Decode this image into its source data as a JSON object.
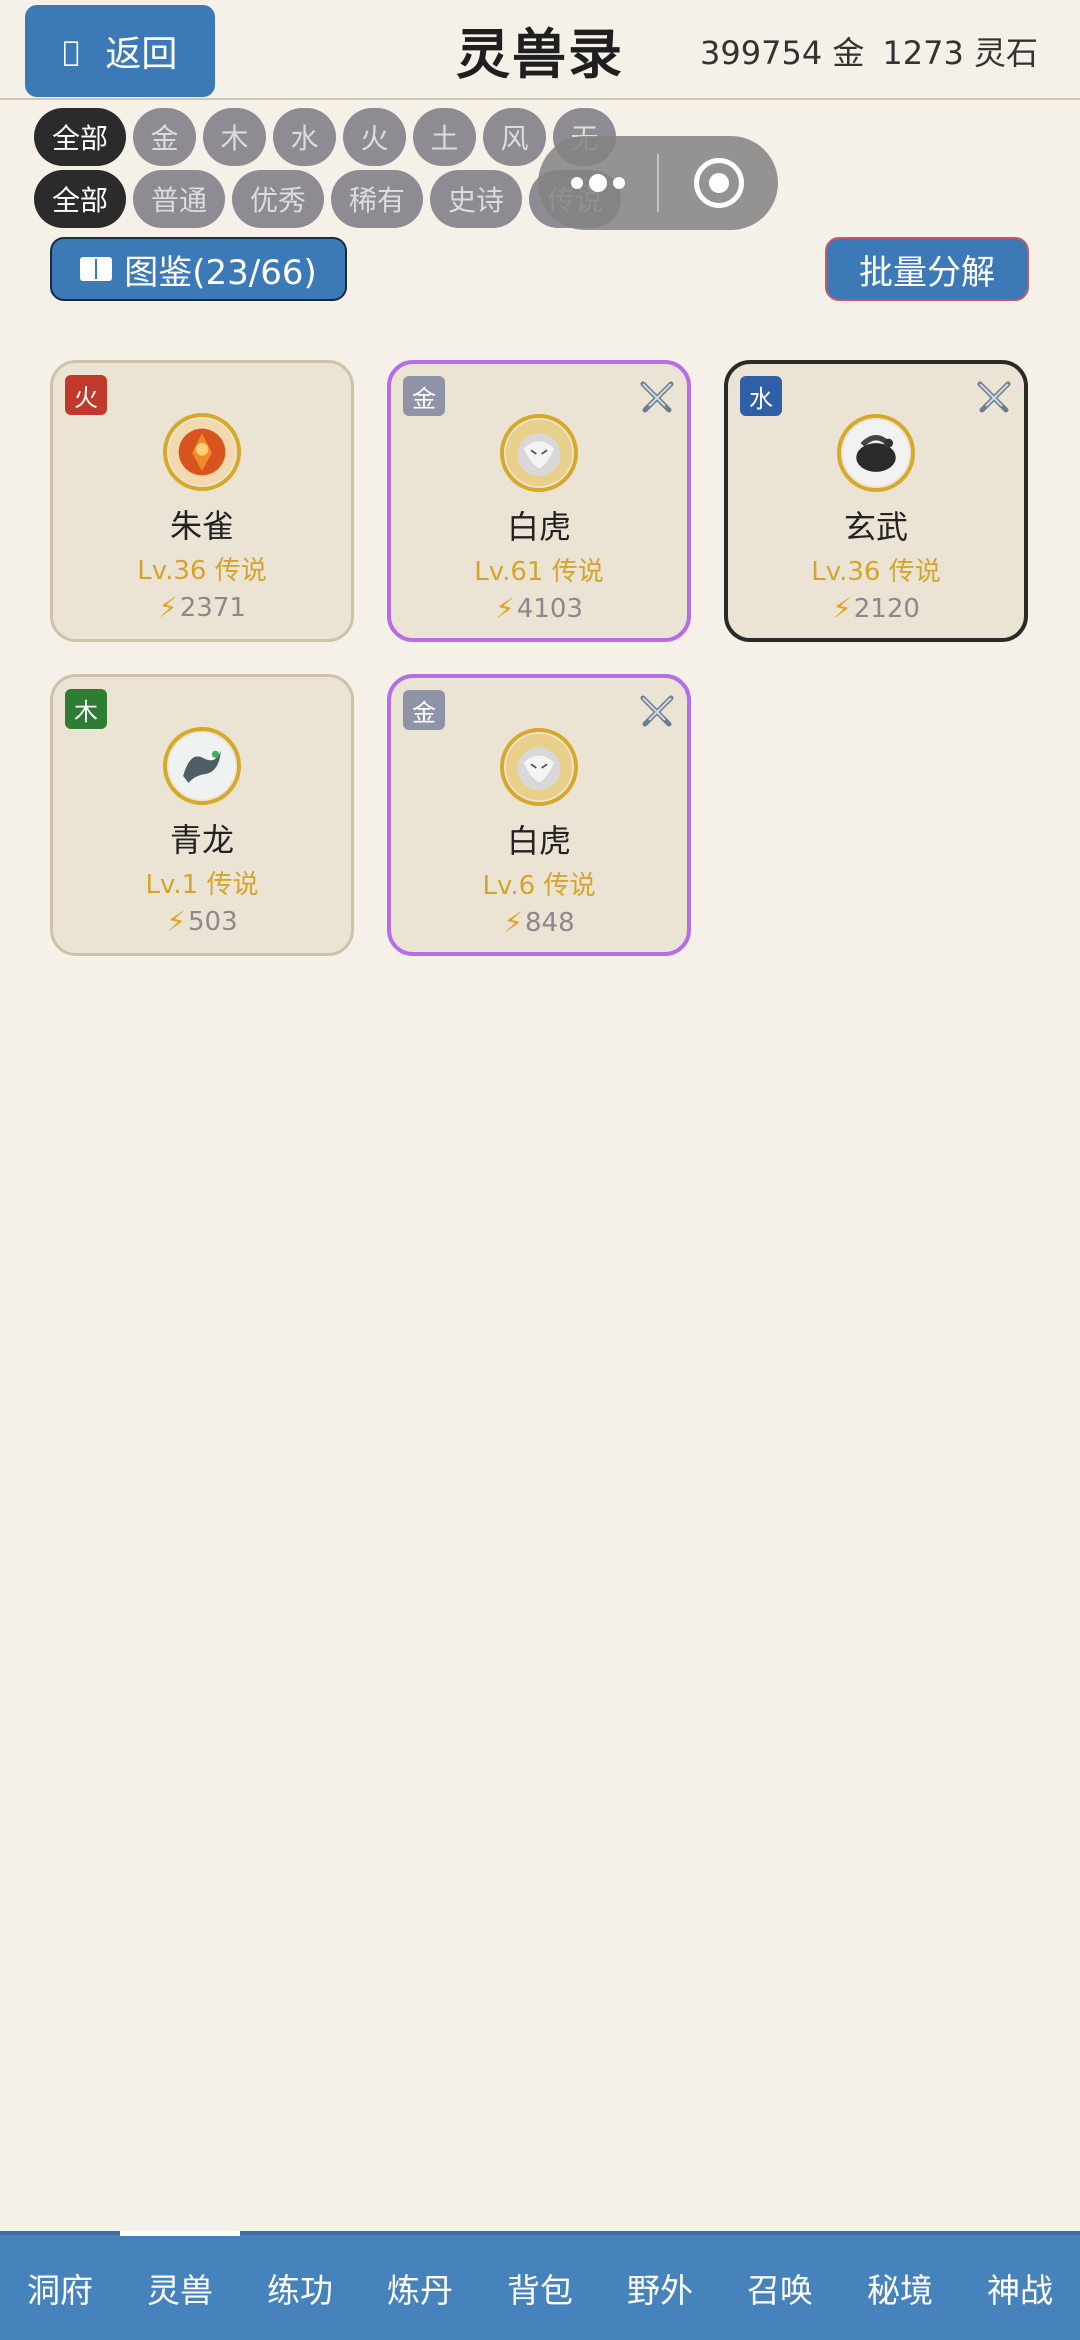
{
  "header": {
    "back_label": "返回",
    "back_icon": "left-arrow-icon",
    "title": "灵兽录",
    "gold": "399754 金",
    "stones": "1273 灵石"
  },
  "filters": {
    "elements": [
      "全部",
      "金",
      "木",
      "水",
      "火",
      "土",
      "风",
      "无"
    ],
    "rarities": [
      "全部",
      "普通",
      "优秀",
      "稀有",
      "史诗",
      "传说"
    ],
    "selected_element": "全部",
    "selected_rarity": "全部"
  },
  "actions": {
    "handbook_label": "图鉴(23/66)",
    "decompose_label": "批量分解"
  },
  "beasts": [
    {
      "name": "朱雀",
      "element": "火",
      "element_color": "#c0392b",
      "level": "Lv.36 传说",
      "power": "2371",
      "equipped": false,
      "avatar": "vermilion-bird-icon"
    },
    {
      "name": "白虎",
      "element": "金",
      "element_color": "#8f93a8",
      "level": "Lv.61 传说",
      "power": "4103",
      "equipped": true,
      "avatar": "white-tiger-icon"
    },
    {
      "name": "玄武",
      "element": "水",
      "element_color": "#2f5fa6",
      "level": "Lv.36 传说",
      "power": "2120",
      "equipped": true,
      "avatar": "black-tortoise-icon"
    },
    {
      "name": "青龙",
      "element": "木",
      "element_color": "#2e7d32",
      "level": "Lv.1 传说",
      "power": "503",
      "equipped": false,
      "avatar": "azure-dragon-icon"
    },
    {
      "name": "白虎",
      "element": "金",
      "element_color": "#8f93a8",
      "level": "Lv.6 传说",
      "power": "848",
      "equipped": true,
      "avatar": "white-tiger-icon"
    }
  ],
  "nav": {
    "items": [
      "洞府",
      "灵兽",
      "练功",
      "炼丹",
      "背包",
      "野外",
      "召唤",
      "秘境",
      "神战"
    ],
    "active": "灵兽"
  },
  "colors": {
    "accent": "#3c7ab7",
    "background": "#f5f0e8",
    "card": "#ebe3d4",
    "epic_border": "#b56ee8",
    "level_text": "#d4a52e"
  }
}
